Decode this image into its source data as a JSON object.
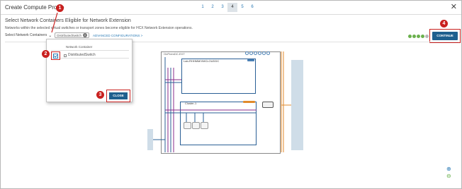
{
  "window": {
    "title": "Create Compute Profile",
    "close_icon": "close-icon"
  },
  "wizard": {
    "steps": [
      "1",
      "2",
      "3",
      "4",
      "5",
      "6"
    ],
    "active_step": "4"
  },
  "page": {
    "heading": "Select Network Containers Eligible for Network Extension",
    "description": "Networks within the selected virtual switches or transport zones become eligible for HCX Network Extension operations.",
    "select_label": "Select Network Containers",
    "selected_chip": "DistributedSwitch",
    "advanced_link": "ADVANCED CONFIGURATIONS >"
  },
  "continue_button": "CONTINUE",
  "dropdown": {
    "column_header": "Network Container",
    "rows": [
      {
        "label": "DistributedSwitch",
        "checked": true
      }
    ],
    "close_button": "CLOSE"
  },
  "callouts": [
    "1",
    "2",
    "3",
    "4"
  ],
  "diagram": {
    "datacenter_label": "OnPremDC-EXT",
    "lab_label": "Lab-RHHMM/VMCLOUDDC",
    "cluster_label": "Cluster-1"
  },
  "colors": {
    "accent": "#1e5f8e",
    "callout": "#c9201f",
    "progress_done": "#6ab04c",
    "orange_line": "#e08a2b",
    "purple_line": "#8a2b8a"
  },
  "icons": {
    "zoom_in": "zoom-in-icon",
    "zoom_out": "zoom-out-icon"
  }
}
